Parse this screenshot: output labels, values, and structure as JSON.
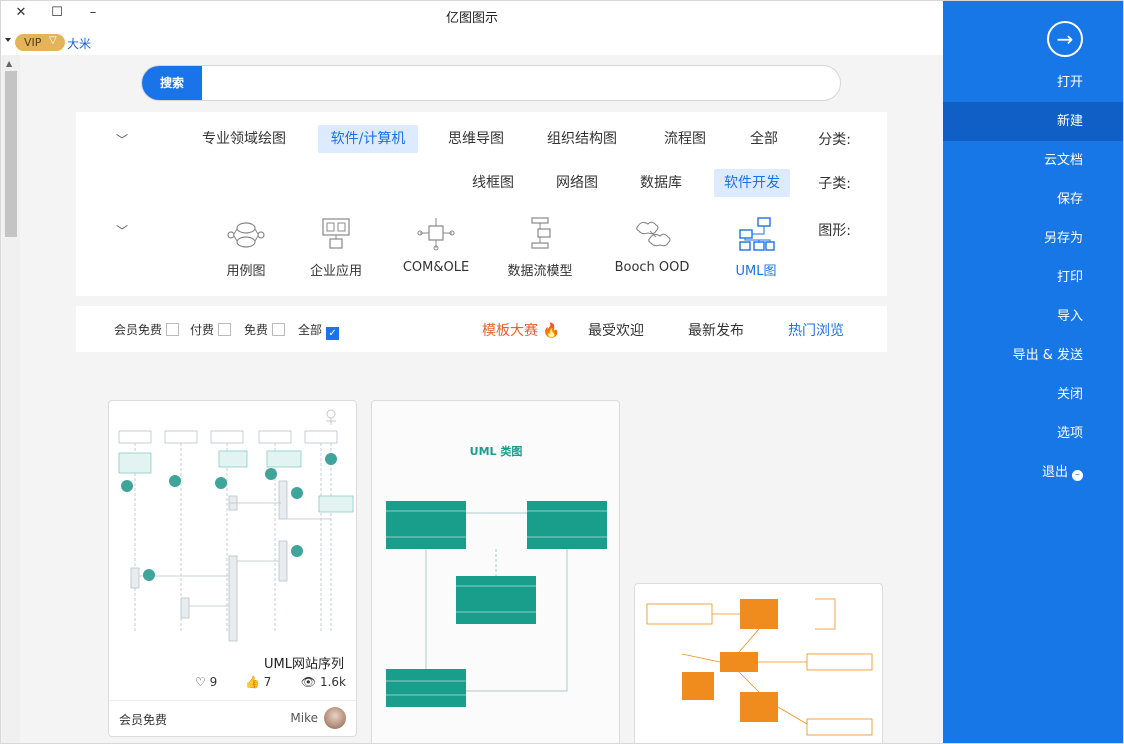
{
  "window": {
    "title": "亿图图示",
    "close_glyph": "✕",
    "max_glyph": "☐",
    "min_glyph": "–"
  },
  "user": {
    "vip_label": "VIP",
    "name": "大米"
  },
  "search": {
    "button_label": "搜索",
    "placeholder": "",
    "value": ""
  },
  "filters": {
    "category_label": "分类:",
    "categories": [
      "全部",
      "流程图",
      "组织结构图",
      "思维导图",
      "软件/计算机",
      "专业领域绘图"
    ],
    "active_category": "软件/计算机",
    "subcategory_label": "子类:",
    "subcategories": [
      "软件开发",
      "数据库",
      "网络图",
      "线框图"
    ],
    "active_subcategory": "软件开发",
    "shape_label": "图形:",
    "shapes": [
      "UML图",
      "Booch OOD",
      "数据流模型",
      "COM&OLE",
      "企业应用",
      "用例图"
    ],
    "active_shape": "UML图"
  },
  "sort": {
    "items": [
      "热门浏览",
      "最新发布",
      "最受欢迎",
      "模板大赛"
    ],
    "active": "热门浏览",
    "checks": [
      "全部",
      "免费",
      "付费",
      "会员免费"
    ],
    "checked": "全部",
    "check_glyph": "✓"
  },
  "cards": [
    {
      "title": "UML网站序列",
      "views": "1.6k",
      "likes": "7",
      "favs": "9",
      "author": "Mike",
      "price": "会员免费"
    },
    {
      "title": "UML 类图"
    },
    {
      "title": ""
    }
  ],
  "sidebar": {
    "items": [
      "打开",
      "新建",
      "云文档",
      "保存",
      "另存为",
      "打印",
      "导入",
      "导出 & 发送",
      "关闭",
      "选项",
      "退出"
    ],
    "active": "新建"
  },
  "colors": {
    "accent": "#1877e6",
    "teal": "#1a9e8c",
    "orange": "#f08c1e",
    "hot": "#e8612c"
  }
}
